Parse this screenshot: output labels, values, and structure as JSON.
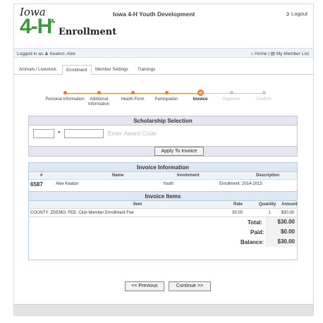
{
  "header": {
    "logo_text_top": "Iowa",
    "logo_text_mid": "4-H",
    "logo_text_bottom": "Enrollment",
    "title": "Iowa 4-H Youth Development",
    "logout_label": "Logout"
  },
  "userbar": {
    "logged_in": "Logged in as",
    "user_name": "Keaton: Alex",
    "home_label": "Home",
    "member_list_label": "My Member List"
  },
  "tabs": [
    {
      "label": "Animals / Livestock"
    },
    {
      "label": "Enrollment"
    },
    {
      "label": "Member Settings"
    },
    {
      "label": "Trainings"
    }
  ],
  "steps": [
    {
      "label": "Personal Information"
    },
    {
      "label": "Additional Information"
    },
    {
      "label": "Health Form"
    },
    {
      "label": "Participation"
    },
    {
      "label": "Invoice"
    },
    {
      "label": "Payment"
    },
    {
      "label": "Confirm"
    }
  ],
  "scholarship": {
    "title": "Scholarship Selection",
    "code_part1": "",
    "code_part2": "",
    "placeholder": "Enter Award Code",
    "apply_label": "Apply To Invoice"
  },
  "invoice_info": {
    "title": "Invoice Information",
    "columns": {
      "num": "#",
      "name": "Name",
      "involvement": "Involvment",
      "description": "Description"
    },
    "row": {
      "num": "6587",
      "name": "Alex Keaton",
      "involvement": "Youth",
      "description": "Enrollment: 2014-2015"
    }
  },
  "invoice_items": {
    "title": "Invoice Items",
    "columns": {
      "item": "Item",
      "rate": "Rate",
      "quantity": "Quantity",
      "amount": "Amount"
    },
    "rows": [
      {
        "item": "COUNTY: ZDEMO: FEE: Club Member Enrollment Fee",
        "rate": "30.00",
        "quantity": "1",
        "amount": "$30.00"
      }
    ],
    "total_label": "Total:",
    "total": "$30.00",
    "paid_label": "Paid:",
    "paid": "$0.00",
    "balance_label": "Balance:",
    "balance": "$30.00"
  },
  "nav": {
    "previous_label": "<< Previous",
    "continue_label": "Continue >>"
  },
  "colors": {
    "accent_orange": "#e8792e",
    "inactive_gray": "#c8c8c8",
    "brand_green": "#3d9a3d"
  }
}
